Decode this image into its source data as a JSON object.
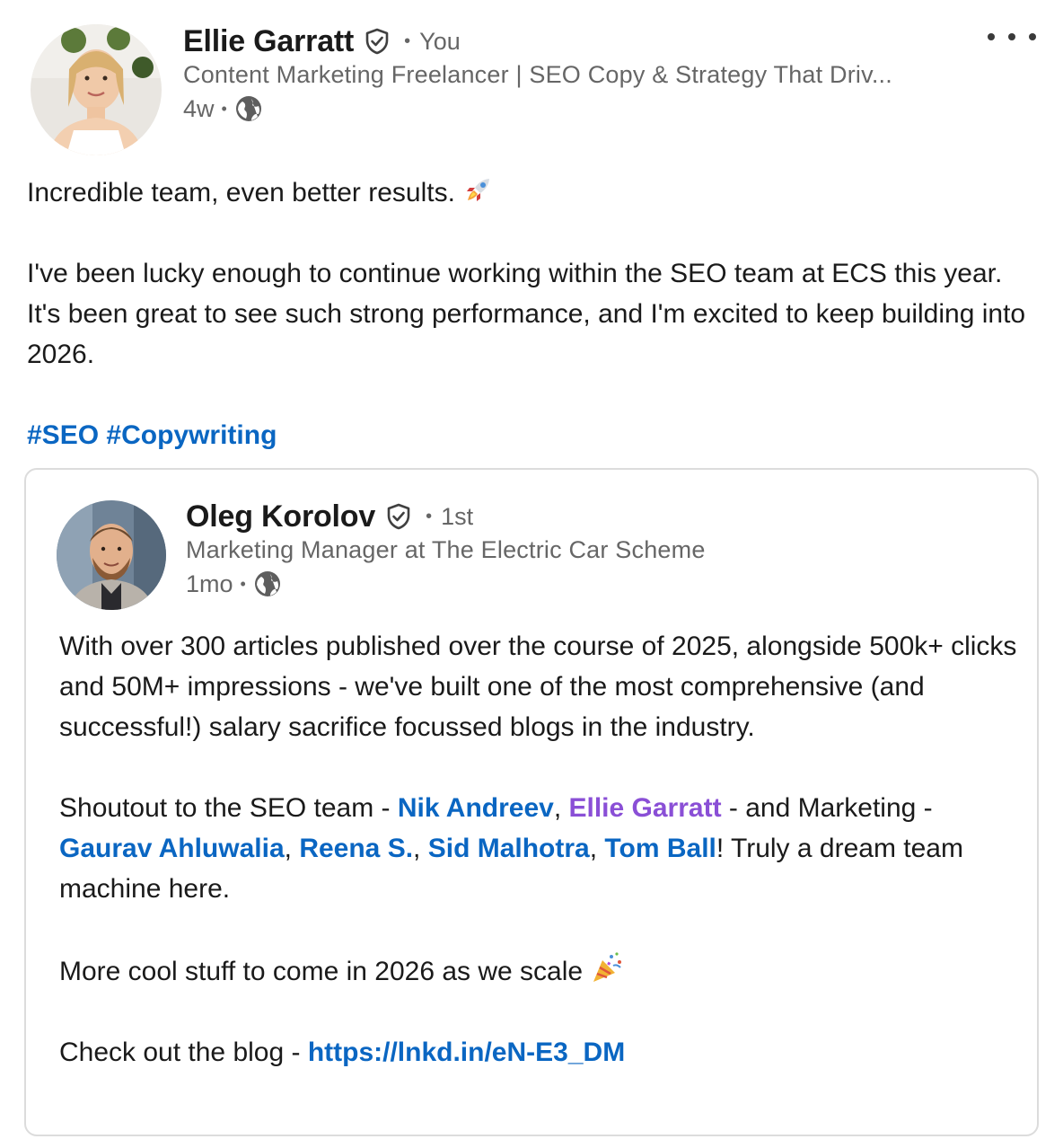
{
  "post": {
    "author": {
      "name": "Ellie Garratt",
      "relation": "You",
      "headline": "Content Marketing Freelancer | SEO Copy & Strategy That Driv...",
      "time": "4w"
    },
    "body": {
      "line1": "Incredible team, even better results. ",
      "line2": "I've been lucky enough to continue working within the SEO team at ECS this year. It's been great to see such strong performance, and I'm excited to keep building into 2026.",
      "hashtags": [
        "#SEO",
        "#Copywriting"
      ]
    }
  },
  "shared": {
    "author": {
      "name": "Oleg Korolov",
      "relation": "1st",
      "headline": "Marketing Manager at The Electric Car Scheme",
      "time": "1mo"
    },
    "para1": "With over 300 articles published over the course of 2025, alongside 500k+ clicks and 50M+ impressions - we've built one of the most comprehensive (and successful!) salary sacrifice focussed blogs in the industry.",
    "para2": {
      "t1": "Shoutout to the SEO team - ",
      "m1": "Nik Andreev",
      "c1": ", ",
      "m2": "Ellie Garratt",
      "t2": " - and Marketing - ",
      "m3": "Gaurav Ahluwalia",
      "c2": ", ",
      "m4": "Reena S.",
      "c3": ", ",
      "m5": "Sid Malhotra",
      "c4": ", ",
      "m6": "Tom Ball",
      "t3": "! Truly a dream team machine here."
    },
    "para3": "More cool stuff to come in 2026 as we scale ",
    "para4": {
      "text": "Check out the blog - ",
      "link": "https://lnkd.in/eN-E3_DM"
    }
  },
  "icons": {
    "verified": "verified-shield-icon",
    "visibility": "globe-icon",
    "menu": "more-horizontal-icon",
    "emoji1": "rocket-emoji",
    "emoji2": "party-popper-emoji"
  },
  "colors": {
    "link": "#0a66c2",
    "self_mention": "#8a4fd6",
    "secondary_text": "#666666"
  }
}
